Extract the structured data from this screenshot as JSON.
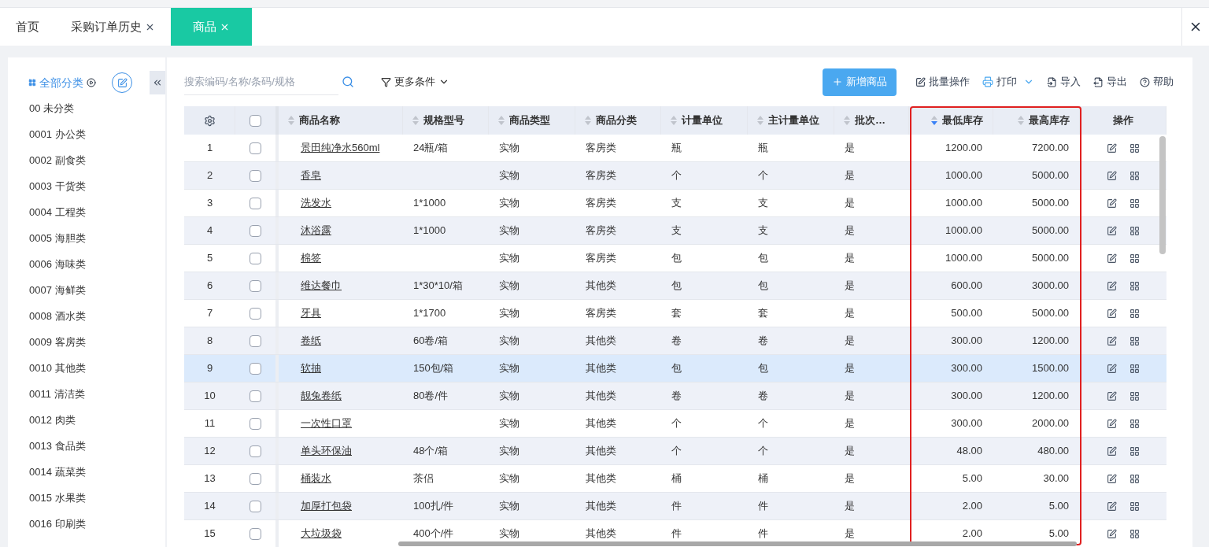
{
  "tabs": [
    {
      "label": "首页",
      "selected": false,
      "closable": false
    },
    {
      "label": "采购订单历史",
      "selected": false,
      "closable": true
    },
    {
      "label": "商品",
      "selected": true,
      "closable": true
    }
  ],
  "sidebar": {
    "all_label": "全部分类",
    "all_selected": true,
    "items": [
      "00 未分类",
      "0001 办公类",
      "0002 副食类",
      "0003 干货类",
      "0004 工程类",
      "0005 海胆类",
      "0006 海味类",
      "0007 海鲜类",
      "0008 酒水类",
      "0009 客房类",
      "0010 其他类",
      "0011 清洁类",
      "0012 肉类",
      "0013 食品类",
      "0014 蔬菜类",
      "0015 水果类",
      "0016 印刷类"
    ]
  },
  "search": {
    "placeholder": "搜索编码/名称/条码/规格"
  },
  "filter_label": "更多条件",
  "toolbar": [
    {
      "kind": "primary",
      "label": "新增商品"
    },
    {
      "kind": "batch",
      "label": "批量操作"
    },
    {
      "kind": "print",
      "label": "打印"
    },
    {
      "kind": "import",
      "label": "导入"
    },
    {
      "kind": "export",
      "label": "导出"
    },
    {
      "kind": "help",
      "label": "帮助"
    }
  ],
  "table": {
    "select_all_checked": false,
    "columns": [
      {
        "kind": "text",
        "label": "商品名称",
        "sorted": false
      },
      {
        "kind": "text",
        "label": "规格型号",
        "sorted": false
      },
      {
        "kind": "text",
        "label": "商品类型",
        "sorted": false
      },
      {
        "kind": "text",
        "label": "商品分类",
        "sorted": false
      },
      {
        "kind": "text",
        "label": "计量单位",
        "sorted": false
      },
      {
        "kind": "text",
        "label": "主计量单位",
        "sorted": false
      },
      {
        "kind": "text",
        "label": "批次…",
        "sorted": false
      },
      {
        "kind": "num",
        "label": "最低库存",
        "sorted": true
      },
      {
        "kind": "num",
        "label": "最高库存",
        "sorted": false
      },
      {
        "kind": "ops",
        "label": "操作"
      }
    ],
    "rows": [
      {
        "no": "1",
        "checked": false,
        "selected": false,
        "cells": [
          "景田纯净水560ml",
          "24瓶/箱",
          "实物",
          "客房类",
          "瓶",
          "瓶",
          "是",
          "1200.00",
          "7200.00"
        ]
      },
      {
        "no": "2",
        "checked": false,
        "selected": false,
        "cells": [
          "香皂",
          "",
          "实物",
          "客房类",
          "个",
          "个",
          "是",
          "1000.00",
          "5000.00"
        ]
      },
      {
        "no": "3",
        "checked": false,
        "selected": false,
        "cells": [
          "洗发水",
          "1*1000",
          "实物",
          "客房类",
          "支",
          "支",
          "是",
          "1000.00",
          "5000.00"
        ]
      },
      {
        "no": "4",
        "checked": false,
        "selected": false,
        "cells": [
          "沐浴露",
          "1*1000",
          "实物",
          "客房类",
          "支",
          "支",
          "是",
          "1000.00",
          "5000.00"
        ]
      },
      {
        "no": "5",
        "checked": false,
        "selected": false,
        "cells": [
          "棉签",
          "",
          "实物",
          "客房类",
          "包",
          "包",
          "是",
          "1000.00",
          "5000.00"
        ]
      },
      {
        "no": "6",
        "checked": false,
        "selected": false,
        "cells": [
          "维达餐巾",
          "1*30*10/箱",
          "实物",
          "其他类",
          "包",
          "包",
          "是",
          "600.00",
          "3000.00"
        ]
      },
      {
        "no": "7",
        "checked": false,
        "selected": false,
        "cells": [
          "牙具",
          "1*1700",
          "实物",
          "客房类",
          "套",
          "套",
          "是",
          "500.00",
          "5000.00"
        ]
      },
      {
        "no": "8",
        "checked": false,
        "selected": false,
        "cells": [
          "卷纸",
          "60卷/箱",
          "实物",
          "其他类",
          "卷",
          "卷",
          "是",
          "300.00",
          "1200.00"
        ]
      },
      {
        "no": "9",
        "checked": false,
        "selected": true,
        "cells": [
          "软抽",
          "150包/箱",
          "实物",
          "其他类",
          "包",
          "包",
          "是",
          "300.00",
          "1500.00"
        ]
      },
      {
        "no": "10",
        "checked": false,
        "selected": false,
        "cells": [
          "靓兔卷纸",
          "80卷/件",
          "实物",
          "其他类",
          "卷",
          "卷",
          "是",
          "300.00",
          "1200.00"
        ]
      },
      {
        "no": "11",
        "checked": false,
        "selected": false,
        "cells": [
          "一次性口罩",
          "",
          "实物",
          "其他类",
          "个",
          "个",
          "是",
          "300.00",
          "2000.00"
        ]
      },
      {
        "no": "12",
        "checked": false,
        "selected": false,
        "cells": [
          "单头环保油",
          "48个/箱",
          "实物",
          "其他类",
          "个",
          "个",
          "是",
          "48.00",
          "480.00"
        ]
      },
      {
        "no": "13",
        "checked": false,
        "selected": false,
        "cells": [
          "桶装水",
          "茶侣",
          "实物",
          "其他类",
          "桶",
          "桶",
          "是",
          "5.00",
          "30.00"
        ]
      },
      {
        "no": "14",
        "checked": false,
        "selected": false,
        "cells": [
          "加厚打包袋",
          "100扎/件",
          "实物",
          "其他类",
          "件",
          "件",
          "是",
          "2.00",
          "5.00"
        ]
      },
      {
        "no": "15",
        "checked": false,
        "selected": false,
        "cells": [
          "大垃圾袋",
          "400个/件",
          "实物",
          "其他类",
          "件",
          "件",
          "是",
          "2.00",
          "5.00"
        ]
      }
    ]
  }
}
